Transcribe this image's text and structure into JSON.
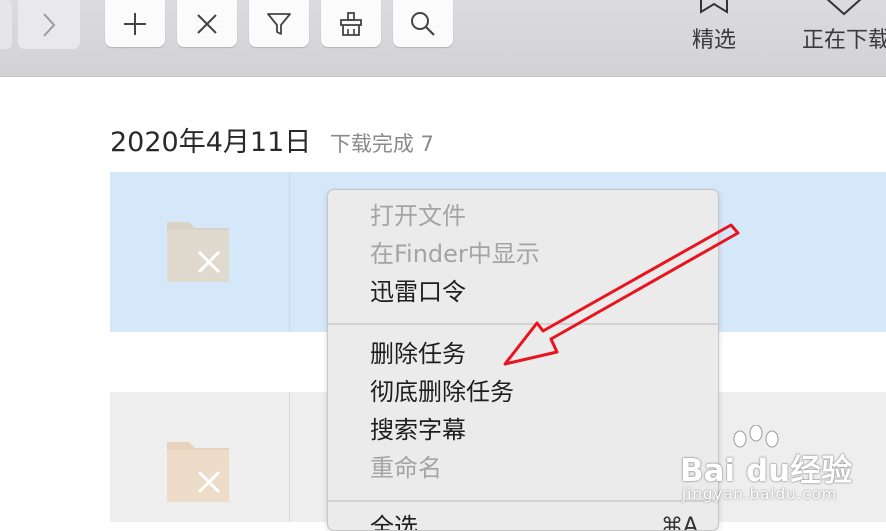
{
  "toolbar": {
    "buttons": [
      {
        "icon": "forward-chevron-icon"
      },
      {
        "icon": "plus-icon"
      },
      {
        "icon": "close-x-icon"
      },
      {
        "icon": "filter-funnel-icon"
      },
      {
        "icon": "cleanup-brush-icon"
      },
      {
        "icon": "search-icon"
      }
    ],
    "tabs": [
      {
        "label": "精选",
        "icon": "bookmark-icon"
      },
      {
        "label": "正在下载",
        "icon": "chevron-down-icon"
      }
    ]
  },
  "list": {
    "date": "2020年4月11日",
    "status": "下载完成 7",
    "rows": [
      {
        "selected": true,
        "icon": "folder-broken-icon"
      },
      {
        "selected": false,
        "icon": "folder-broken-icon"
      }
    ]
  },
  "context_menu": {
    "group1": [
      {
        "label": "打开文件",
        "enabled": false
      },
      {
        "label": "在Finder中显示",
        "enabled": false
      },
      {
        "label": "迅雷口令",
        "enabled": true
      }
    ],
    "group2": [
      {
        "label": "删除任务",
        "enabled": true
      },
      {
        "label": "彻底删除任务",
        "enabled": true
      },
      {
        "label": "搜索字幕",
        "enabled": true
      },
      {
        "label": "重命名",
        "enabled": false
      }
    ],
    "group3": [
      {
        "label": "全选",
        "shortcut": "⌘A",
        "enabled": true
      }
    ]
  },
  "annotation": {
    "color": "#e8141e"
  },
  "watermark": {
    "brand": "Bai du经验",
    "url": "jingyan.baidu.com"
  },
  "colors": {
    "selection": "#d5e8fa",
    "menu_bg": "#ebebeb",
    "toolbar_bg": "#d6d6d9"
  }
}
